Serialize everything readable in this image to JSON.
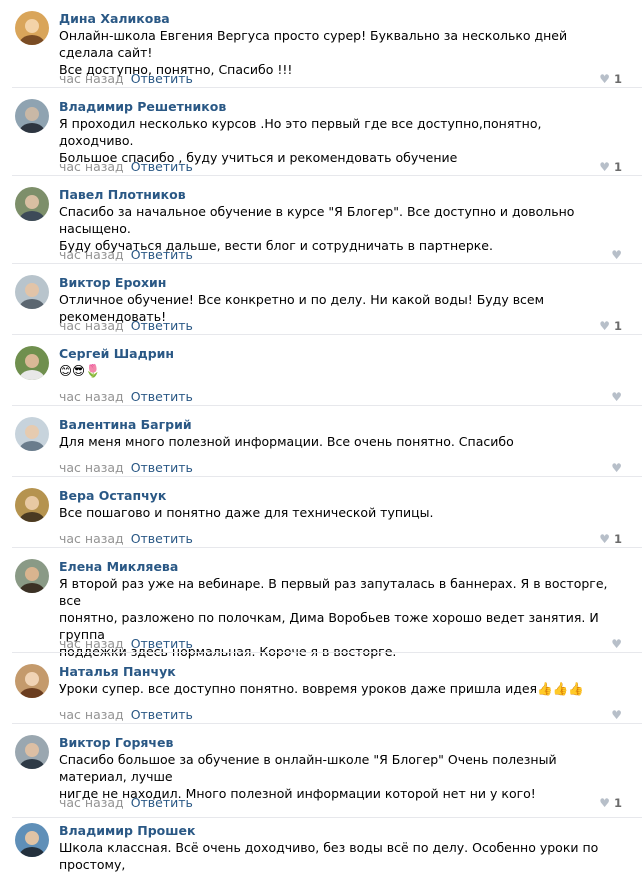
{
  "comments": [
    {
      "author": "Дина Халикова",
      "text": "Онлайн-школа Евгения Вергуса просто сурер! Буквально за несколько дней сделала сайт!\nВсе доступно, понятно, Спасибо !!!",
      "time": "час назад",
      "reply": "Ответить",
      "likes": "1",
      "avatar_colors": [
        "#d9a55a",
        "#f3d3a8",
        "#7a4c24"
      ]
    },
    {
      "author": "Владимир Решетников",
      "text": "Я проходил несколько курсов .Но это первый где все доступно,понятно, доходчиво.\nБольшое спасибо , буду учиться и рекомендовать обучение",
      "time": "час назад",
      "reply": "Ответить",
      "likes": "1",
      "avatar_colors": [
        "#8fa3b1",
        "#c9b8a6",
        "#2d3540"
      ]
    },
    {
      "author": "Павел Плотников",
      "text": "Спасибо за начальное обучение в курсе \"Я Блогер\". Все доступно и довольно насыщено.\nБуду обучаться дальше, вести блог и сотрудничать в партнерке.",
      "time": "час назад",
      "reply": "Ответить",
      "likes": "",
      "avatar_colors": [
        "#7d8f6a",
        "#d8bfa2",
        "#3d4a58"
      ]
    },
    {
      "author": "Виктор Ерохин",
      "text": "Отличное обучение! Все конкретно и по делу. Ни какой воды! Буду всем рекомендовать!",
      "time": "час назад",
      "reply": "Ответить",
      "likes": "1",
      "avatar_colors": [
        "#b8c4cc",
        "#e2c4a8",
        "#5b6670"
      ]
    },
    {
      "author": "Сергей Шадрин",
      "text": "😊😎🌷",
      "time": "час назад",
      "reply": "Ответить",
      "likes": "",
      "avatar_colors": [
        "#6f8f4e",
        "#d9b896",
        "#e8e8e8"
      ]
    },
    {
      "author": "Валентина Багрий",
      "text": "Для меня много полезной информации. Все очень понятно. Спасибо",
      "time": "час назад",
      "reply": "Ответить",
      "likes": "",
      "avatar_colors": [
        "#c7d3dc",
        "#e6cbb0",
        "#6a7c8c"
      ]
    },
    {
      "author": "Вера Остапчук",
      "text": "Все пошагово и понятно даже для технической тупицы.",
      "time": "час назад",
      "reply": "Ответить",
      "likes": "1",
      "avatar_colors": [
        "#b5934f",
        "#e8c9a3",
        "#4a3a22"
      ]
    },
    {
      "author": "Елена Микляева",
      "text": "Я второй раз уже на вебинаре. В первый раз запуталась в баннерах. Я в восторге, все\nпонятно, разложено по полочкам, Дима Воробьев тоже хорошо ведет занятия. И группа\nподдежки здесь нормальная. Короче я в восторге.",
      "time": "час назад",
      "reply": "Ответить",
      "likes": "",
      "avatar_colors": [
        "#8a9a86",
        "#d9b48f",
        "#3b3125"
      ]
    },
    {
      "author": "Наталья Панчук",
      "text": "Уроки супер. все доступно понятно. вовремя уроков даже пришла идея👍👍👍",
      "time": "час назад",
      "reply": "Ответить",
      "likes": "",
      "avatar_colors": [
        "#c49a6c",
        "#f0d3b5",
        "#6b3d1f"
      ]
    },
    {
      "author": "Виктор Горячев",
      "text": "Спасибо большое за обучение в онлайн-школе \"Я Блогер\" Очень полезный материал, лучше\nнигде не находил. Много полезной информации которой нет ни у кого!",
      "time": "час назад",
      "reply": "Ответить",
      "likes": "1",
      "avatar_colors": [
        "#9aa7b0",
        "#dcbfa4",
        "#2e3a46"
      ]
    },
    {
      "author": "Владимир Прошек",
      "text": "Школа классная. Всё очень доходчиво, без воды всё по делу. Особенно уроки по простому,",
      "time": "",
      "reply": "",
      "likes": "",
      "avatar_colors": [
        "#5f8fb8",
        "#e0c3a5",
        "#23303d"
      ]
    }
  ]
}
